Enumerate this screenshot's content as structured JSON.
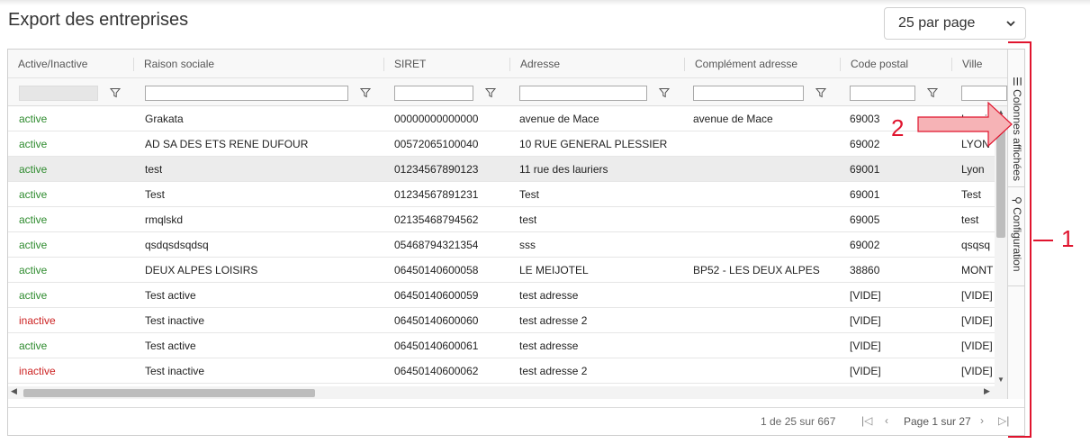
{
  "page": {
    "title": "Export des entreprises",
    "per_page": "25 par page"
  },
  "columns": [
    {
      "label": "Active/Inactive"
    },
    {
      "label": "Raison sociale"
    },
    {
      "label": "SIRET"
    },
    {
      "label": "Adresse"
    },
    {
      "label": "Complément adresse"
    },
    {
      "label": "Code postal"
    },
    {
      "label": "Ville"
    }
  ],
  "rows": [
    {
      "status": "active",
      "raison": "Grakata",
      "siret": "00000000000000",
      "adresse": "avenue de Mace",
      "complement": "avenue de Mace",
      "cp": "69003",
      "ville": "Lançi..."
    },
    {
      "status": "active",
      "raison": "AD SA DES ETS RENE DUFOUR",
      "siret": "00572065100040",
      "adresse": "10 RUE GENERAL PLESSIER",
      "complement": "",
      "cp": "69002",
      "ville": "LYON"
    },
    {
      "status": "active",
      "raison": "test",
      "siret": "01234567890123",
      "adresse": "11 rue des lauriers",
      "complement": "",
      "cp": "69001",
      "ville": "Lyon"
    },
    {
      "status": "active",
      "raison": "Test",
      "siret": "01234567891231",
      "adresse": "Test",
      "complement": "",
      "cp": "69001",
      "ville": "Test"
    },
    {
      "status": "active",
      "raison": "rmqlskd",
      "siret": "02135468794562",
      "adresse": "test",
      "complement": "",
      "cp": "69005",
      "ville": "test"
    },
    {
      "status": "active",
      "raison": "qsdqsdsqdsq",
      "siret": "05468794321354",
      "adresse": "sss",
      "complement": "",
      "cp": "69002",
      "ville": "qsqsq"
    },
    {
      "status": "active",
      "raison": "DEUX ALPES LOISIRS",
      "siret": "06450140600058",
      "adresse": "LE MEIJOTEL",
      "complement": "BP52 - LES DEUX ALPES",
      "cp": "38860",
      "ville": "MONT"
    },
    {
      "status": "active",
      "raison": "Test active",
      "siret": "06450140600059",
      "adresse": "test adresse",
      "complement": "",
      "cp": "[VIDE]",
      "ville": "[VIDE]"
    },
    {
      "status": "inactive",
      "raison": "Test inactive",
      "siret": "06450140600060",
      "adresse": "test adresse 2",
      "complement": "",
      "cp": "[VIDE]",
      "ville": "[VIDE]"
    },
    {
      "status": "active",
      "raison": "Test active",
      "siret": "06450140600061",
      "adresse": "test adresse",
      "complement": "",
      "cp": "[VIDE]",
      "ville": "[VIDE]"
    },
    {
      "status": "inactive",
      "raison": "Test inactive",
      "siret": "06450140600062",
      "adresse": "test adresse 2",
      "complement": "",
      "cp": "[VIDE]",
      "ville": "[VIDE]"
    }
  ],
  "side_panel": {
    "columns_tab": "Colonnes affichées",
    "config_tab": "Configuration"
  },
  "footer": {
    "count": "1 de 25 sur 667",
    "page_info": "Page 1 sur 27"
  },
  "annotations": {
    "label_1": "1",
    "label_2": "2",
    "color": "#e0142e"
  },
  "colors": {
    "active": "#2e8b2e",
    "inactive": "#cc2222"
  }
}
